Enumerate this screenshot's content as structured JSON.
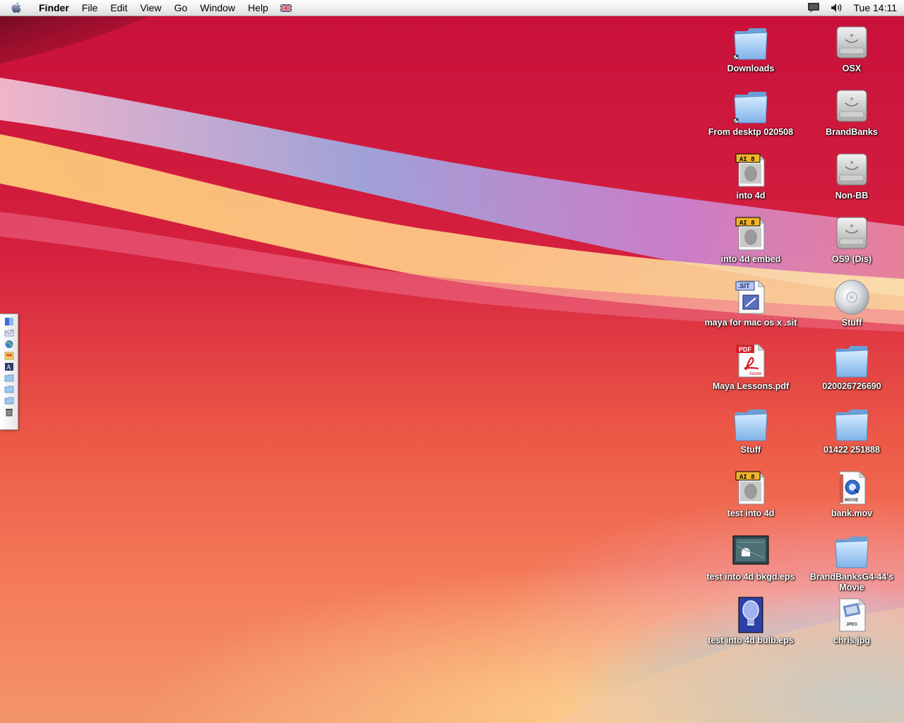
{
  "menubar": {
    "app_name": "Finder",
    "menus": [
      "File",
      "Edit",
      "View",
      "Go",
      "Window",
      "Help"
    ],
    "clock": "Tue 14:11"
  },
  "desktop_icons": {
    "col1": [
      {
        "label": "Downloads",
        "icon": "alias-folder-icon"
      },
      {
        "label": "From desktp 020508",
        "icon": "alias-folder-icon"
      },
      {
        "label": "into 4d",
        "icon": "illustrator-file-icon"
      },
      {
        "label": "into 4d embed",
        "icon": "illustrator-file-icon"
      },
      {
        "label": "maya for mac os x .sit",
        "icon": "stuffit-archive-icon"
      },
      {
        "label": "Maya Lessons.pdf",
        "icon": "pdf-file-icon"
      },
      {
        "label": "Stuff",
        "icon": "folder-icon"
      },
      {
        "label": "test into 4d",
        "icon": "illustrator-file-icon"
      },
      {
        "label": "test into 4d bkgd.eps",
        "icon": "eps-image-icon"
      },
      {
        "label": "test into 4d bulb.eps",
        "icon": "eps-bulb-icon"
      }
    ],
    "col2": [
      {
        "label": "OSX",
        "icon": "hard-drive-icon"
      },
      {
        "label": "BrandBanks",
        "icon": "hard-drive-icon"
      },
      {
        "label": "Non-BB",
        "icon": "hard-drive-icon"
      },
      {
        "label": "OS9 (Dis)",
        "icon": "hard-drive-icon"
      },
      {
        "label": "Stuff",
        "icon": "cd-disc-icon"
      },
      {
        "label": "020026726690",
        "icon": "folder-icon"
      },
      {
        "label": "01422 251888",
        "icon": "folder-icon"
      },
      {
        "label": "bank.mov",
        "icon": "quicktime-movie-icon"
      },
      {
        "label": "BrandBanksG4-44's Movie",
        "icon": "folder-icon"
      },
      {
        "label": "chris.jpg",
        "icon": "jpeg-file-icon"
      }
    ]
  },
  "badges": {
    "illustrator": "AI 8",
    "pdf": "PDF",
    "adobe": "Adobe",
    "sit": ".SIT",
    "movie": "MOVIE",
    "jpeg": "JPEG"
  }
}
